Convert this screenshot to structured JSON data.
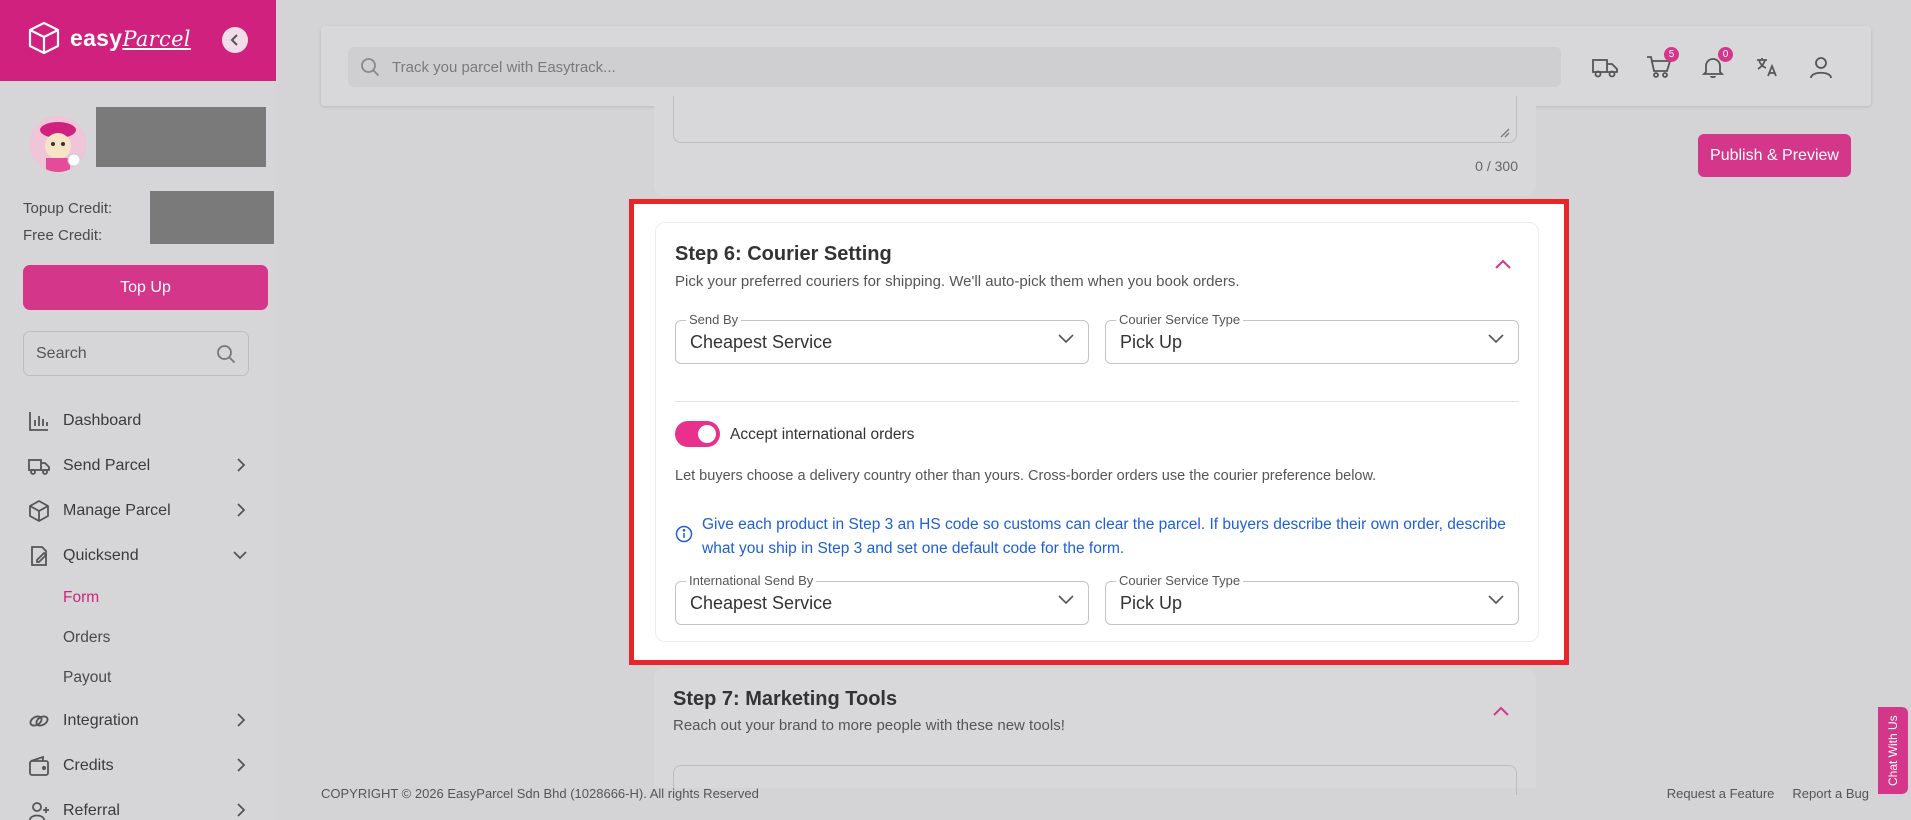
{
  "brand": {
    "logo_text": "easy",
    "logo_script": "Parcel"
  },
  "sidebar": {
    "topup_credit_label": "Topup Credit:",
    "free_credit_label": "Free Credit:",
    "topup_button": "Top Up",
    "search_placeholder": "Search",
    "items": [
      {
        "label": "Dashboard",
        "icon": "chart-bar-icon"
      },
      {
        "label": "Send Parcel",
        "icon": "truck-icon"
      },
      {
        "label": "Manage Parcel",
        "icon": "box-icon"
      },
      {
        "label": "Quicksend",
        "icon": "edit-box-icon"
      },
      {
        "label": "Integration",
        "icon": "link-icon"
      },
      {
        "label": "Credits",
        "icon": "wallet-icon"
      },
      {
        "label": "Referral",
        "icon": "user-plus-icon"
      }
    ],
    "quicksend_sub": [
      "Form",
      "Orders",
      "Payout"
    ]
  },
  "topbar": {
    "track_placeholder": "Track you parcel with Easytrack...",
    "cart_badge": "5",
    "notification_badge": "0"
  },
  "prev_section": {
    "char_count": "0 / 300"
  },
  "publish_button": "Publish & Preview",
  "step6": {
    "title": "Step 6: Courier Setting",
    "description": "Pick your preferred couriers for shipping. We'll auto-pick them when you book orders.",
    "send_by_label": "Send By",
    "send_by_value": "Cheapest Service",
    "service_type_label": "Courier Service Type",
    "service_type_value": "Pick Up",
    "toggle_label": "Accept international orders",
    "toggle_on": true,
    "intl_description": "Let buyers choose a delivery country other than yours. Cross-border orders use the courier preference below.",
    "info_text": "Give each product in Step 3 an HS code so customs can clear the parcel. If buyers describe their own order, describe what you ship in Step 3 and set one default code for the form.",
    "intl_send_by_label": "International Send By",
    "intl_send_by_value": "Cheapest Service",
    "intl_service_type_label": "Courier Service Type",
    "intl_service_type_value": "Pick Up"
  },
  "step7": {
    "title": "Step 7: Marketing Tools",
    "description": "Reach out your brand to more people with these new tools!"
  },
  "footer": {
    "copyright": "COPYRIGHT © 2026 EasyParcel Sdn Bhd (1028666-H). All rights Reserved",
    "request_feature": "Request a Feature",
    "report_bug": "Report a Bug"
  },
  "chat_tab": "Chat With Us",
  "colors": {
    "brand_pink": "#d0217f",
    "info_blue": "#1e5fd6",
    "highlight_red": "#e8262a"
  }
}
